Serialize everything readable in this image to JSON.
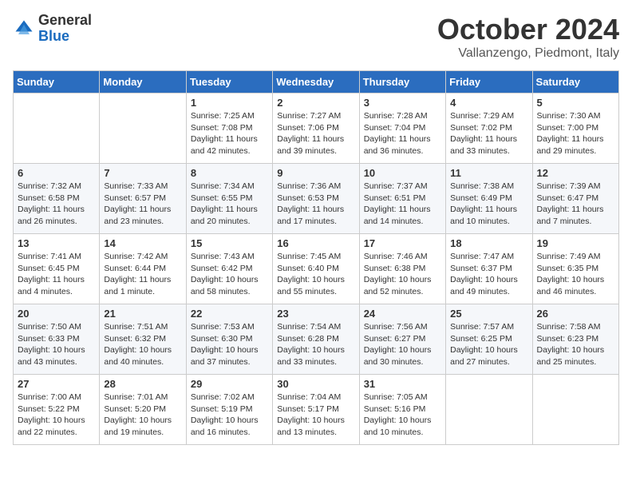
{
  "header": {
    "logo_general": "General",
    "logo_blue": "Blue",
    "month_title": "October 2024",
    "location": "Vallanzengo, Piedmont, Italy"
  },
  "weekdays": [
    "Sunday",
    "Monday",
    "Tuesday",
    "Wednesday",
    "Thursday",
    "Friday",
    "Saturday"
  ],
  "weeks": [
    {
      "days": [
        {
          "number": "",
          "info": ""
        },
        {
          "number": "",
          "info": ""
        },
        {
          "number": "1",
          "info": "Sunrise: 7:25 AM\nSunset: 7:08 PM\nDaylight: 11 hours and 42 minutes."
        },
        {
          "number": "2",
          "info": "Sunrise: 7:27 AM\nSunset: 7:06 PM\nDaylight: 11 hours and 39 minutes."
        },
        {
          "number": "3",
          "info": "Sunrise: 7:28 AM\nSunset: 7:04 PM\nDaylight: 11 hours and 36 minutes."
        },
        {
          "number": "4",
          "info": "Sunrise: 7:29 AM\nSunset: 7:02 PM\nDaylight: 11 hours and 33 minutes."
        },
        {
          "number": "5",
          "info": "Sunrise: 7:30 AM\nSunset: 7:00 PM\nDaylight: 11 hours and 29 minutes."
        }
      ]
    },
    {
      "days": [
        {
          "number": "6",
          "info": "Sunrise: 7:32 AM\nSunset: 6:58 PM\nDaylight: 11 hours and 26 minutes."
        },
        {
          "number": "7",
          "info": "Sunrise: 7:33 AM\nSunset: 6:57 PM\nDaylight: 11 hours and 23 minutes."
        },
        {
          "number": "8",
          "info": "Sunrise: 7:34 AM\nSunset: 6:55 PM\nDaylight: 11 hours and 20 minutes."
        },
        {
          "number": "9",
          "info": "Sunrise: 7:36 AM\nSunset: 6:53 PM\nDaylight: 11 hours and 17 minutes."
        },
        {
          "number": "10",
          "info": "Sunrise: 7:37 AM\nSunset: 6:51 PM\nDaylight: 11 hours and 14 minutes."
        },
        {
          "number": "11",
          "info": "Sunrise: 7:38 AM\nSunset: 6:49 PM\nDaylight: 11 hours and 10 minutes."
        },
        {
          "number": "12",
          "info": "Sunrise: 7:39 AM\nSunset: 6:47 PM\nDaylight: 11 hours and 7 minutes."
        }
      ]
    },
    {
      "days": [
        {
          "number": "13",
          "info": "Sunrise: 7:41 AM\nSunset: 6:45 PM\nDaylight: 11 hours and 4 minutes."
        },
        {
          "number": "14",
          "info": "Sunrise: 7:42 AM\nSunset: 6:44 PM\nDaylight: 11 hours and 1 minute."
        },
        {
          "number": "15",
          "info": "Sunrise: 7:43 AM\nSunset: 6:42 PM\nDaylight: 10 hours and 58 minutes."
        },
        {
          "number": "16",
          "info": "Sunrise: 7:45 AM\nSunset: 6:40 PM\nDaylight: 10 hours and 55 minutes."
        },
        {
          "number": "17",
          "info": "Sunrise: 7:46 AM\nSunset: 6:38 PM\nDaylight: 10 hours and 52 minutes."
        },
        {
          "number": "18",
          "info": "Sunrise: 7:47 AM\nSunset: 6:37 PM\nDaylight: 10 hours and 49 minutes."
        },
        {
          "number": "19",
          "info": "Sunrise: 7:49 AM\nSunset: 6:35 PM\nDaylight: 10 hours and 46 minutes."
        }
      ]
    },
    {
      "days": [
        {
          "number": "20",
          "info": "Sunrise: 7:50 AM\nSunset: 6:33 PM\nDaylight: 10 hours and 43 minutes."
        },
        {
          "number": "21",
          "info": "Sunrise: 7:51 AM\nSunset: 6:32 PM\nDaylight: 10 hours and 40 minutes."
        },
        {
          "number": "22",
          "info": "Sunrise: 7:53 AM\nSunset: 6:30 PM\nDaylight: 10 hours and 37 minutes."
        },
        {
          "number": "23",
          "info": "Sunrise: 7:54 AM\nSunset: 6:28 PM\nDaylight: 10 hours and 33 minutes."
        },
        {
          "number": "24",
          "info": "Sunrise: 7:56 AM\nSunset: 6:27 PM\nDaylight: 10 hours and 30 minutes."
        },
        {
          "number": "25",
          "info": "Sunrise: 7:57 AM\nSunset: 6:25 PM\nDaylight: 10 hours and 27 minutes."
        },
        {
          "number": "26",
          "info": "Sunrise: 7:58 AM\nSunset: 6:23 PM\nDaylight: 10 hours and 25 minutes."
        }
      ]
    },
    {
      "days": [
        {
          "number": "27",
          "info": "Sunrise: 7:00 AM\nSunset: 5:22 PM\nDaylight: 10 hours and 22 minutes."
        },
        {
          "number": "28",
          "info": "Sunrise: 7:01 AM\nSunset: 5:20 PM\nDaylight: 10 hours and 19 minutes."
        },
        {
          "number": "29",
          "info": "Sunrise: 7:02 AM\nSunset: 5:19 PM\nDaylight: 10 hours and 16 minutes."
        },
        {
          "number": "30",
          "info": "Sunrise: 7:04 AM\nSunset: 5:17 PM\nDaylight: 10 hours and 13 minutes."
        },
        {
          "number": "31",
          "info": "Sunrise: 7:05 AM\nSunset: 5:16 PM\nDaylight: 10 hours and 10 minutes."
        },
        {
          "number": "",
          "info": ""
        },
        {
          "number": "",
          "info": ""
        }
      ]
    }
  ]
}
